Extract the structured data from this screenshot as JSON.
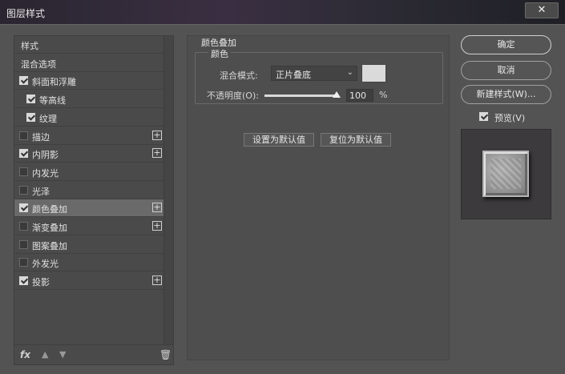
{
  "window": {
    "title": "图层样式",
    "close_label": "✕"
  },
  "styles_list": {
    "items": [
      {
        "label": "样式",
        "checkbox": false,
        "checked": false,
        "plus": false,
        "indent": 0,
        "selected": false
      },
      {
        "label": "混合选项",
        "checkbox": false,
        "checked": false,
        "plus": false,
        "indent": 0,
        "selected": false
      },
      {
        "label": "斜面和浮雕",
        "checkbox": true,
        "checked": true,
        "plus": false,
        "indent": 0,
        "selected": false
      },
      {
        "label": "等高线",
        "checkbox": true,
        "checked": true,
        "plus": false,
        "indent": 1,
        "selected": false
      },
      {
        "label": "纹理",
        "checkbox": true,
        "checked": true,
        "plus": false,
        "indent": 1,
        "selected": false
      },
      {
        "label": "描边",
        "checkbox": true,
        "checked": false,
        "plus": true,
        "indent": 0,
        "selected": false
      },
      {
        "label": "内阴影",
        "checkbox": true,
        "checked": true,
        "plus": true,
        "indent": 0,
        "selected": false
      },
      {
        "label": "内发光",
        "checkbox": true,
        "checked": false,
        "plus": false,
        "indent": 0,
        "selected": false
      },
      {
        "label": "光泽",
        "checkbox": true,
        "checked": false,
        "plus": false,
        "indent": 0,
        "selected": false
      },
      {
        "label": "颜色叠加",
        "checkbox": true,
        "checked": true,
        "plus": true,
        "indent": 0,
        "selected": true
      },
      {
        "label": "渐变叠加",
        "checkbox": true,
        "checked": false,
        "plus": true,
        "indent": 0,
        "selected": false
      },
      {
        "label": "图案叠加",
        "checkbox": true,
        "checked": false,
        "plus": false,
        "indent": 0,
        "selected": false
      },
      {
        "label": "外发光",
        "checkbox": true,
        "checked": false,
        "plus": false,
        "indent": 0,
        "selected": false
      },
      {
        "label": "投影",
        "checkbox": true,
        "checked": true,
        "plus": true,
        "indent": 0,
        "selected": false
      }
    ],
    "footer": {
      "fx_label": "fx",
      "up_icon": "arrow-up-icon",
      "down_icon": "arrow-down-icon",
      "trash_icon": "trash-icon"
    }
  },
  "color_overlay": {
    "section_title": "颜色叠加",
    "group_title": "颜色",
    "blend_mode_label": "混合模式:",
    "blend_mode_value": "正片叠底",
    "swatch_color": "#dadadb",
    "opacity_label": "不透明度(O):",
    "opacity_value": "100",
    "opacity_unit": "%",
    "opacity_fraction": 1.0,
    "set_default_label": "设置为默认值",
    "reset_default_label": "复位为默认值"
  },
  "actions": {
    "ok_label": "确定",
    "cancel_label": "取消",
    "new_style_label": "新建样式(W)...",
    "preview_label": "预览(V)",
    "preview_checked": true
  }
}
